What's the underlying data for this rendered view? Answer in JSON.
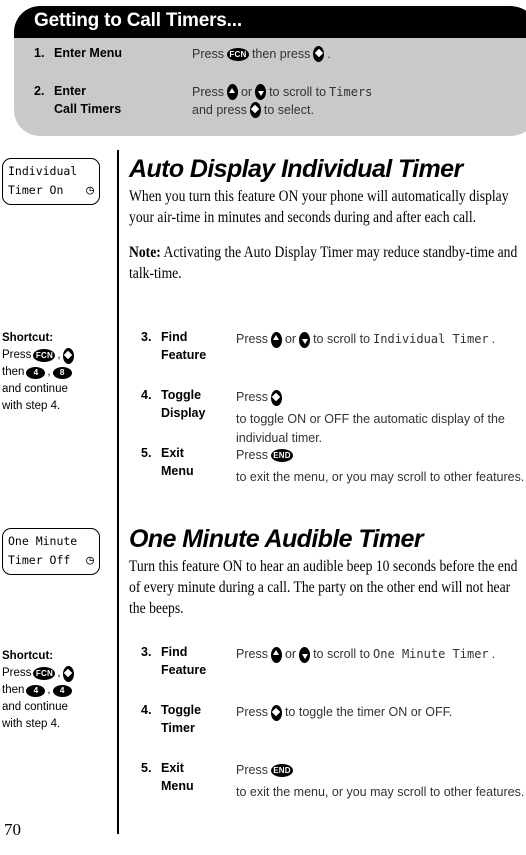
{
  "page": {
    "number": "70"
  },
  "intro": {
    "title": "Getting to Call Timers...",
    "rows": [
      {
        "num": "1.",
        "label": "Enter Menu",
        "label2": "",
        "text_pre": "Press",
        "key1": "FCN",
        "text_mid": "then press",
        "key2": "select",
        "text_post": ".",
        "text2": ""
      },
      {
        "num": "2.",
        "label": "Enter",
        "label2": "Call Timers",
        "text_pre": "Press",
        "key1": "up",
        "text_mid": "or",
        "key2": "down",
        "text_post": "to scroll to",
        "mono_post": "Timers",
        "line2_pre": "and press",
        "line2_key": "select",
        "line2_post": "to select."
      }
    ]
  },
  "sections": [
    {
      "lcd": {
        "line1": "Individual",
        "line2": "Timer On",
        "clock": "๏"
      },
      "title": "Auto Display Individual Timer",
      "body": "When you turn this feature ON your phone will automatically display your air-time in minutes and seconds during and after each call.",
      "note_label": "Note:",
      "note_body": "Activating the Auto Display Timer may reduce standby-time and talk-time.",
      "shortcut": {
        "title": "Shortcut:",
        "press_label": "Press",
        "key_fcn": "FCN",
        "key_sel": "select",
        "then_label": "then",
        "key_a": "4",
        "key_b": "8",
        "continue_line1": "and continue",
        "continue_line2": "with step 4."
      },
      "steps": [
        {
          "num": "3.",
          "label": "Find",
          "label2": "Feature",
          "pre": "Press",
          "key1": "up",
          "mid": "or",
          "key2": "down",
          "post": "to scroll to",
          "mono": "Individual Timer",
          "tail": "."
        },
        {
          "num": "4.",
          "label": "Toggle",
          "label2": "Display",
          "pre": "Press",
          "key1": "select",
          "mid": "",
          "key2": "",
          "post": "to toggle ON or OFF the automatic display of the individual timer.",
          "mono": "",
          "tail": ""
        },
        {
          "num": "5.",
          "label": "Exit",
          "label2": "Menu",
          "pre": "Press",
          "key1": "END",
          "mid": "",
          "key2": "",
          "post": "to exit the menu, or you may scroll to other features.",
          "mono": "",
          "tail": ""
        }
      ]
    },
    {
      "lcd": {
        "line1": "One Minute",
        "line2": "Timer Off",
        "clock": "๏"
      },
      "title": "One Minute Audible Timer",
      "body": "Turn this feature ON to hear an audible beep 10 seconds before the end of every minute during a call. The party on the other end will not hear the beeps.",
      "note_label": "",
      "note_body": "",
      "shortcut": {
        "title": "Shortcut:",
        "press_label": "Press",
        "key_fcn": "FCN",
        "key_sel": "select",
        "then_label": "then",
        "key_a": "4",
        "key_b": "4",
        "continue_line1": "and continue",
        "continue_line2": "with step 4."
      },
      "steps": [
        {
          "num": "3.",
          "label": "Find",
          "label2": "Feature",
          "pre": "Press",
          "key1": "up",
          "mid": "or",
          "key2": "down",
          "post": "to scroll to",
          "mono": "One Minute Timer",
          "tail": "."
        },
        {
          "num": "4.",
          "label": "Toggle",
          "label2": "Timer",
          "pre": "Press",
          "key1": "select",
          "mid": "",
          "key2": "",
          "post": "to toggle the timer ON or OFF.",
          "mono": "",
          "tail": ""
        },
        {
          "num": "5.",
          "label": "Exit",
          "label2": "Menu",
          "pre": "Press",
          "key1": "END",
          "mid": "",
          "key2": "",
          "post": "to exit the menu, or you may scroll to other features.",
          "mono": "",
          "tail": ""
        }
      ]
    }
  ]
}
